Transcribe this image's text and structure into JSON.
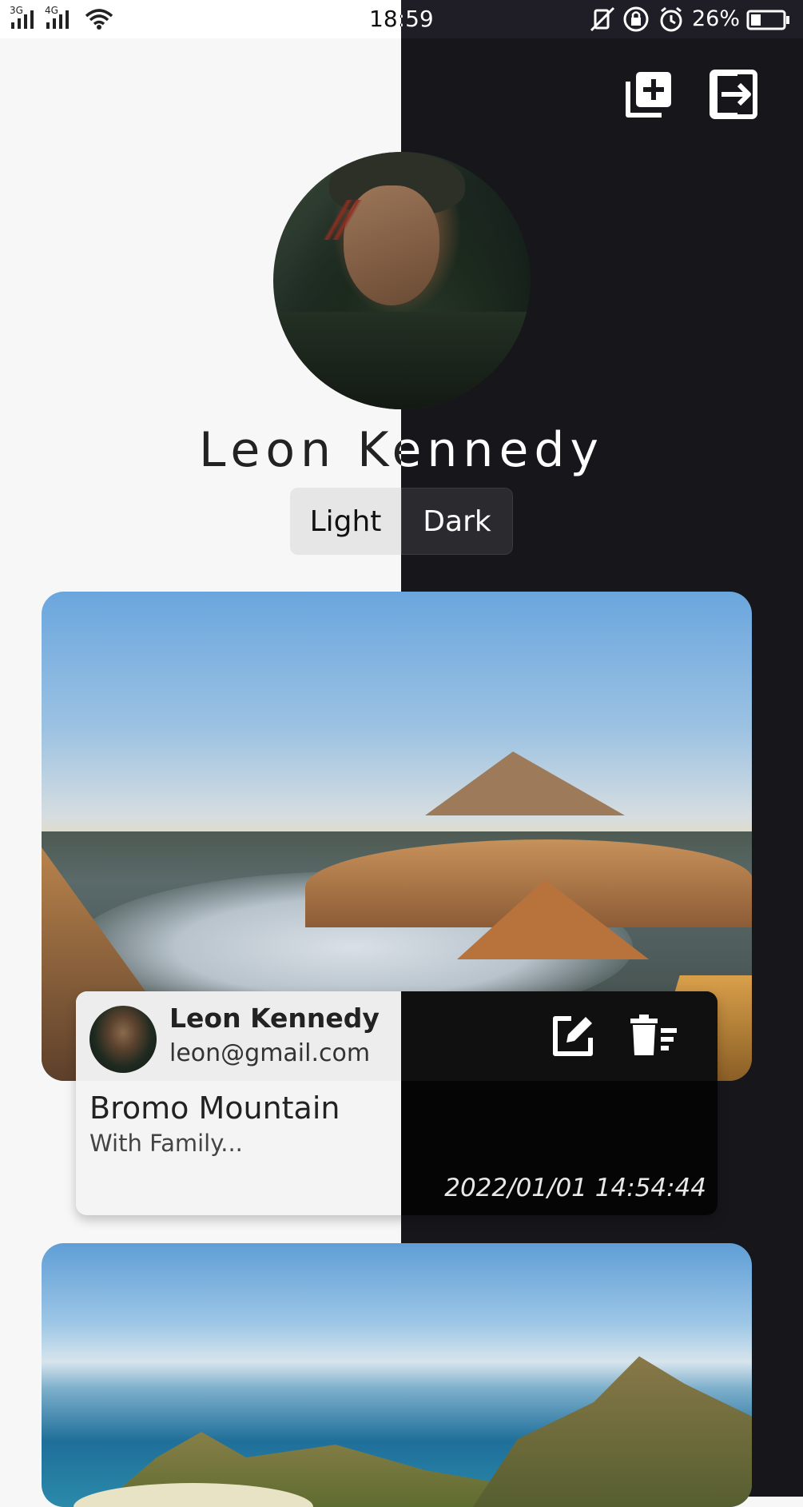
{
  "status_bar": {
    "network_left": "3G",
    "network_right": "4G",
    "time": "18:59",
    "battery_percent": "26%"
  },
  "toolbar": {
    "add_icon": "add-post-icon",
    "logout_icon": "logout-icon"
  },
  "profile": {
    "name": "Leon Kennedy"
  },
  "theme_toggle": {
    "light_label": "Light",
    "dark_label": "Dark",
    "selected": "Dark"
  },
  "posts": [
    {
      "author_name": "Leon Kennedy",
      "author_email": "leon@gmail.com",
      "title": "Bromo Mountain",
      "subtitle": "With Family...",
      "date": "2022/01/01 14:54:44"
    }
  ],
  "colors": {
    "light_bg": "#f7f7f7",
    "dark_bg": "#17161b",
    "card_light": "#f4f4f4",
    "card_dark": "#050505"
  }
}
